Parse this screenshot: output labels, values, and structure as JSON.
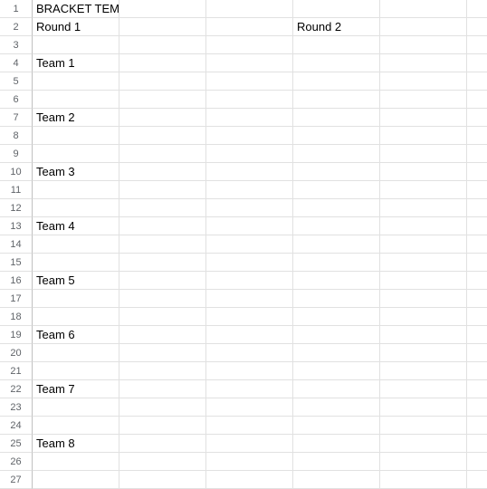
{
  "title": "BRACKET TEMPLATE",
  "headers": {
    "round1": "Round 1",
    "round2": "Round 2"
  },
  "teams": {
    "t1": "Team 1",
    "t2": "Team 2",
    "t3": "Team 3",
    "t4": "Team 4",
    "t5": "Team 5",
    "t6": "Team 6",
    "t7": "Team 7",
    "t8": "Team 8"
  },
  "rows": [
    "1",
    "2",
    "3",
    "4",
    "5",
    "6",
    "7",
    "8",
    "9",
    "10",
    "11",
    "12",
    "13",
    "14",
    "15",
    "16",
    "17",
    "18",
    "19",
    "20",
    "21",
    "22",
    "23",
    "24",
    "25",
    "26",
    "27"
  ]
}
